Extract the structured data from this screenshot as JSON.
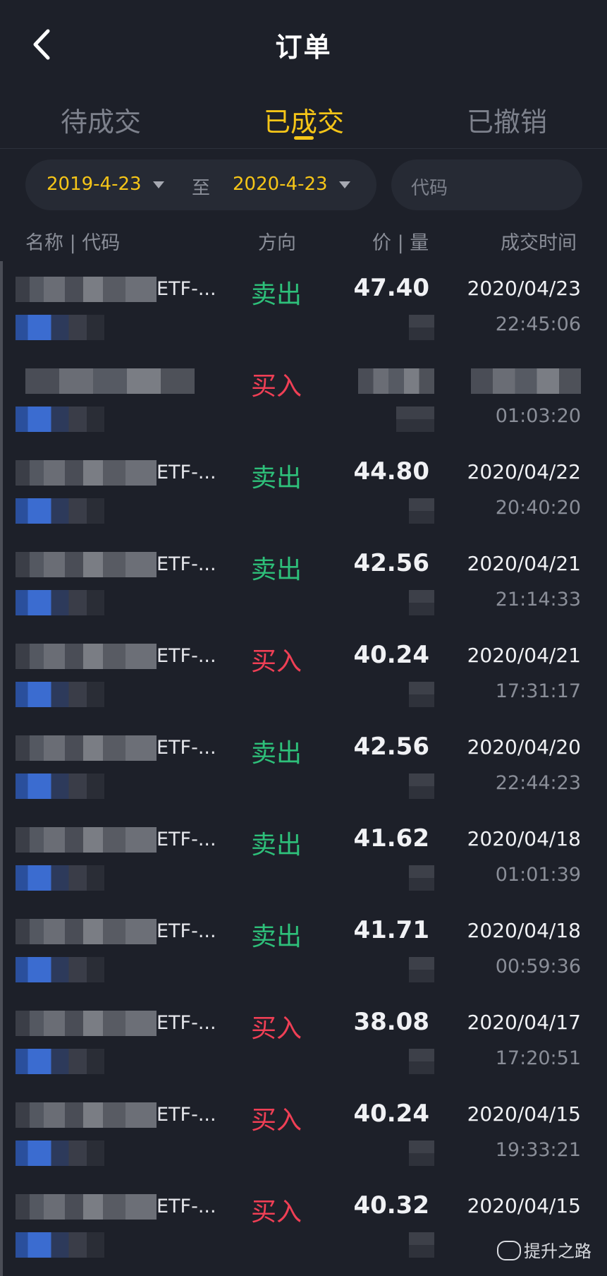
{
  "header": {
    "title": "订单"
  },
  "tabs": [
    {
      "label": "待成交",
      "active": false
    },
    {
      "label": "已成交",
      "active": true
    },
    {
      "label": "已撤销",
      "active": false
    }
  ],
  "filter": {
    "start_date": "2019-4-23",
    "separator": "至",
    "end_date": "2020-4-23",
    "code_placeholder": "代码"
  },
  "columns": {
    "name_code": "名称 | 代码",
    "direction": "方向",
    "price_qty": "价 | 量",
    "time": "成交时间"
  },
  "orders": [
    {
      "name_suffix": "ETF-...",
      "direction": "卖出",
      "type": "sell",
      "price": "47.40",
      "date": "2020/04/23",
      "time": "22:45:06"
    },
    {
      "name_suffix": "",
      "direction": "买入",
      "type": "buy",
      "price": "",
      "date": "",
      "time": "01:03:20"
    },
    {
      "name_suffix": "ETF-...",
      "direction": "卖出",
      "type": "sell",
      "price": "44.80",
      "date": "2020/04/22",
      "time": "20:40:20"
    },
    {
      "name_suffix": "ETF-...",
      "direction": "卖出",
      "type": "sell",
      "price": "42.56",
      "date": "2020/04/21",
      "time": "21:14:33"
    },
    {
      "name_suffix": "ETF-...",
      "direction": "买入",
      "type": "buy",
      "price": "40.24",
      "date": "2020/04/21",
      "time": "17:31:17"
    },
    {
      "name_suffix": "ETF-...",
      "direction": "卖出",
      "type": "sell",
      "price": "42.56",
      "date": "2020/04/20",
      "time": "22:44:23"
    },
    {
      "name_suffix": "ETF-...",
      "direction": "卖出",
      "type": "sell",
      "price": "41.62",
      "date": "2020/04/18",
      "time": "01:01:39"
    },
    {
      "name_suffix": "ETF-...",
      "direction": "卖出",
      "type": "sell",
      "price": "41.71",
      "date": "2020/04/18",
      "time": "00:59:36"
    },
    {
      "name_suffix": "ETF-...",
      "direction": "买入",
      "type": "buy",
      "price": "38.08",
      "date": "2020/04/17",
      "time": "17:20:51"
    },
    {
      "name_suffix": "ETF-...",
      "direction": "买入",
      "type": "buy",
      "price": "40.24",
      "date": "2020/04/15",
      "time": "19:33:21"
    },
    {
      "name_suffix": "ETF-...",
      "direction": "买入",
      "type": "buy",
      "price": "40.32",
      "date": "2020/04/15",
      "time": ""
    }
  ],
  "watermark": "提升之路",
  "colors": {
    "accent": "#f5c518",
    "sell": "#2ec07a",
    "buy": "#ef3f55",
    "background": "#1d2029"
  }
}
